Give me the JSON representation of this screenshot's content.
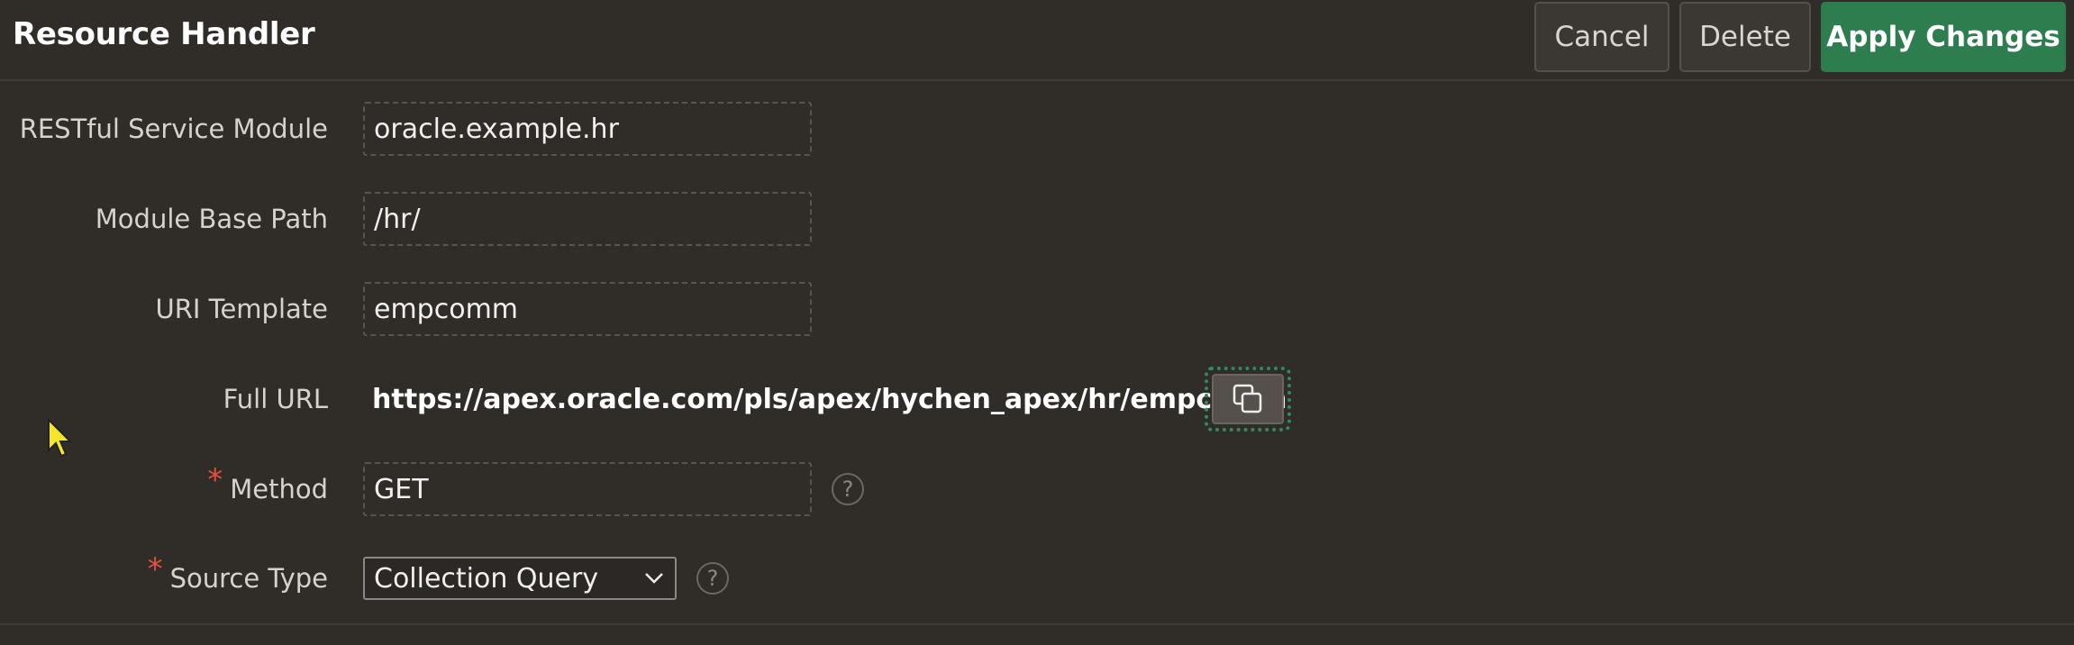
{
  "header": {
    "title": "Resource Handler",
    "cancel_label": "Cancel",
    "delete_label": "Delete",
    "apply_label": "Apply Changes"
  },
  "form": {
    "module": {
      "label": "RESTful Service Module",
      "value": "oracle.example.hr"
    },
    "base_path": {
      "label": "Module Base Path",
      "value": "/hr/"
    },
    "uri_template": {
      "label": "URI Template",
      "value": "empcomm"
    },
    "full_url": {
      "label": "Full URL",
      "value": "https://apex.oracle.com/pls/apex/hychen_apex/hr/empcomm"
    },
    "method": {
      "label": "Method",
      "value": "GET",
      "required_mark": "*"
    },
    "source_type": {
      "label": "Source Type",
      "value": "Collection Query",
      "required_mark": "*"
    },
    "help_glyph": "?"
  },
  "colors": {
    "background": "#302c28",
    "primary_button": "#2e7d4f",
    "required": "#e3503f",
    "cursor": "#f5e62a"
  },
  "icons": {
    "copy": "copy-icon",
    "help": "help-icon",
    "chevron": "chevron-down-icon",
    "cursor": "mouse-pointer-icon"
  }
}
